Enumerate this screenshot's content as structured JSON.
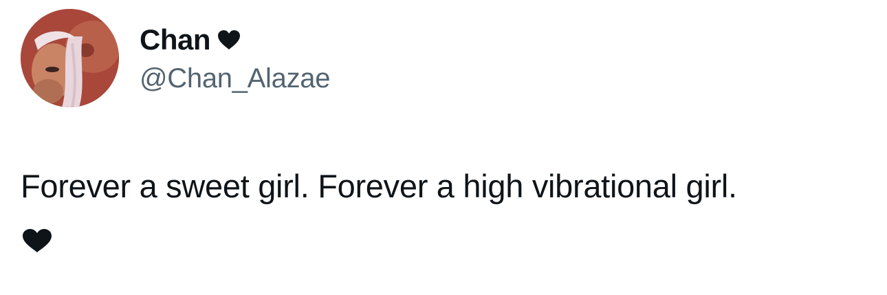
{
  "author": {
    "display_name": "Chan",
    "name_badge_icon": "heart-icon",
    "handle": "@Chan_Alazae"
  },
  "tweet": {
    "text": "Forever a sweet girl. Forever a high vibrational girl.",
    "trailing_emoji_icon": "black-heart-icon"
  },
  "colors": {
    "background": "#ffffff",
    "text_primary": "#0f1419",
    "text_secondary": "#536471",
    "heart": "#0f1419"
  }
}
